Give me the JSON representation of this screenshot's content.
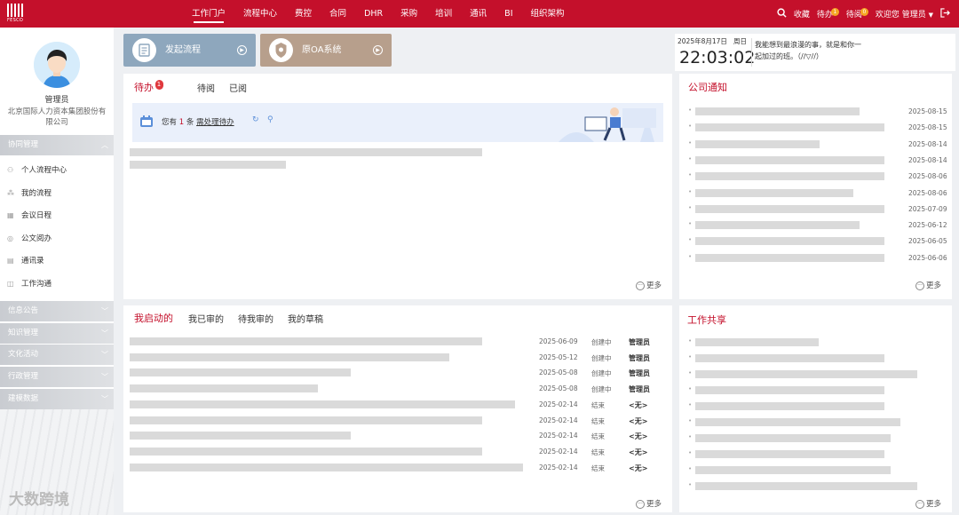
{
  "header": {
    "logo_text": "FESCO",
    "nav": [
      "工作门户",
      "流程中心",
      "费控",
      "合同",
      "DHR",
      "采购",
      "培训",
      "通讯",
      "BI",
      "组织架构"
    ],
    "favorites": "收藏",
    "todo_label": "待办",
    "todo_count": "1",
    "toread_label": "待阅",
    "toread_count": "0",
    "welcome": "欢迎您 管理员",
    "brand_color": "#c4102b"
  },
  "sidebar": {
    "user_name": "管理员",
    "company": "北京国际人力资本集团股份有限公司",
    "sections": [
      {
        "label": "协同管理",
        "items": [
          "个人流程中心",
          "我的流程",
          "会议日程",
          "公文阅办",
          "通讯录",
          "工作沟通"
        ]
      },
      {
        "label": "信息公告"
      },
      {
        "label": "知识管理"
      },
      {
        "label": "文化活动"
      },
      {
        "label": "行政管理"
      },
      {
        "label": "建模数据"
      }
    ]
  },
  "actions": {
    "start_process": "发起流程",
    "original_oa": "原OA系统"
  },
  "clock": {
    "date": "2025年8月17日",
    "weekday": "周日",
    "time": "22:03:02",
    "quote_line1": "我能想到最浪漫的事，就是和你一",
    "quote_line2": "起加过的班。（//▽//）"
  },
  "todo_panel": {
    "tabs": [
      "待办",
      "待阅",
      "已阅"
    ],
    "todo_badge": "1",
    "banner_prefix": "您有",
    "banner_count": "1",
    "banner_unit": "条",
    "banner_link": "需处理待办",
    "more": "更多"
  },
  "notice_panel": {
    "title": "公司通知",
    "dates": [
      "2025-08-15",
      "2025-08-15",
      "2025-08-14",
      "2025-08-14",
      "2025-08-06",
      "2025-08-06",
      "2025-07-09",
      "2025-06-12",
      "2025-06-05",
      "2025-06-06"
    ],
    "more": "更多"
  },
  "started_panel": {
    "tabs": [
      "我启动的",
      "我已审的",
      "待我审的",
      "我的草稿"
    ],
    "rows": [
      {
        "date": "2025-06-09",
        "status": "创建中",
        "owner": "管理员"
      },
      {
        "date": "2025-05-12",
        "status": "创建中",
        "owner": "管理员"
      },
      {
        "date": "2025-05-08",
        "status": "创建中",
        "owner": "管理员"
      },
      {
        "date": "2025-05-08",
        "status": "创建中",
        "owner": "管理员"
      },
      {
        "date": "2025-02-14",
        "status": "结束",
        "owner": "<无>"
      },
      {
        "date": "2025-02-14",
        "status": "结束",
        "owner": "<无>"
      },
      {
        "date": "2025-02-14",
        "status": "结束",
        "owner": "<无>"
      },
      {
        "date": "2025-02-14",
        "status": "结束",
        "owner": "<无>"
      },
      {
        "date": "2025-02-14",
        "status": "结束",
        "owner": "<无>"
      }
    ],
    "more": "更多"
  },
  "share_panel": {
    "title": "工作共享",
    "more": "更多"
  },
  "watermark": "大数跨境"
}
